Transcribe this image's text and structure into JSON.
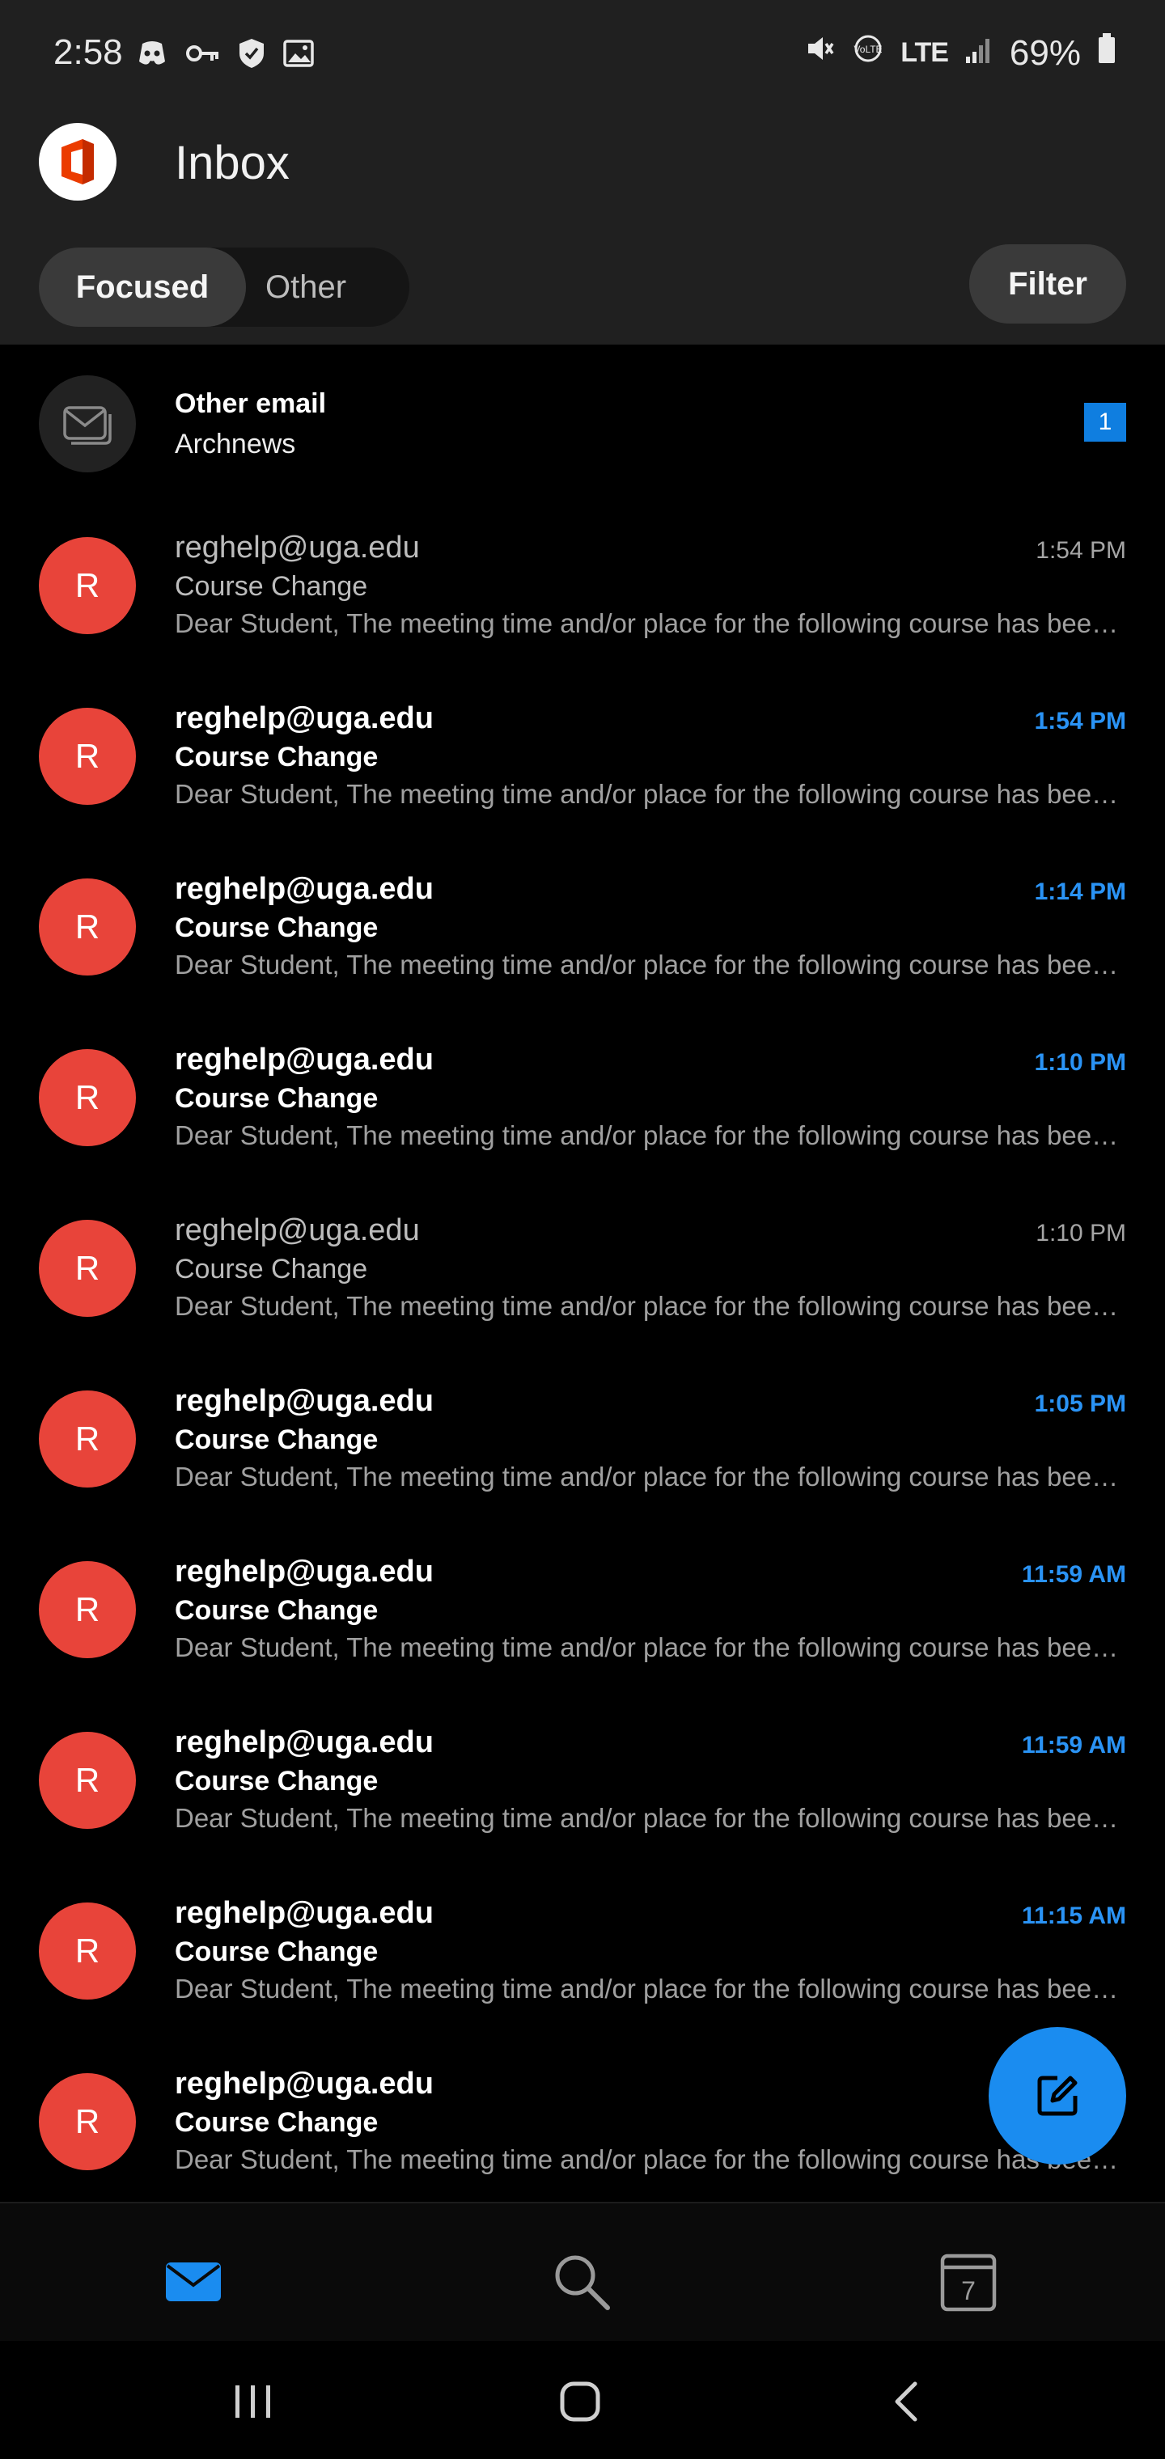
{
  "status_bar": {
    "time": "2:58",
    "network": "LTE",
    "battery": "69%"
  },
  "header": {
    "title": "Inbox",
    "tabs": [
      {
        "label": "Focused",
        "active": true
      },
      {
        "label": "Other",
        "active": false
      }
    ],
    "filter_label": "Filter"
  },
  "other_email": {
    "title": "Other email",
    "sender": "Archnews",
    "count": "1"
  },
  "emails": [
    {
      "initial": "R",
      "from": "reghelp@uga.edu",
      "time": "1:54 PM",
      "subject": "Course Change",
      "preview": "Dear Student, The meeting time and/or place for the following course has been changed",
      "unread": false
    },
    {
      "initial": "R",
      "from": "reghelp@uga.edu",
      "time": "1:54 PM",
      "subject": "Course Change",
      "preview": "Dear Student, The meeting time and/or place for the following course has been changed",
      "unread": true
    },
    {
      "initial": "R",
      "from": "reghelp@uga.edu",
      "time": "1:14 PM",
      "subject": "Course Change",
      "preview": "Dear Student, The meeting time and/or place for the following course has been changed",
      "unread": true
    },
    {
      "initial": "R",
      "from": "reghelp@uga.edu",
      "time": "1:10 PM",
      "subject": "Course Change",
      "preview": "Dear Student, The meeting time and/or place for the following course has been changed",
      "unread": true
    },
    {
      "initial": "R",
      "from": "reghelp@uga.edu",
      "time": "1:10 PM",
      "subject": "Course Change",
      "preview": "Dear Student, The meeting time and/or place for the following course has been changed",
      "unread": false
    },
    {
      "initial": "R",
      "from": "reghelp@uga.edu",
      "time": "1:05 PM",
      "subject": "Course Change",
      "preview": "Dear Student, The meeting time and/or place for the following course has been changed",
      "unread": true
    },
    {
      "initial": "R",
      "from": "reghelp@uga.edu",
      "time": "11:59 AM",
      "subject": "Course Change",
      "preview": "Dear Student, The meeting time and/or place for the following course has been changed",
      "unread": true
    },
    {
      "initial": "R",
      "from": "reghelp@uga.edu",
      "time": "11:59 AM",
      "subject": "Course Change",
      "preview": "Dear Student, The meeting time and/or place for the following course has been changed",
      "unread": true
    },
    {
      "initial": "R",
      "from": "reghelp@uga.edu",
      "time": "11:15 AM",
      "subject": "Course Change",
      "preview": "Dear Student, The meeting time and/or place for the following course has been changed",
      "unread": true
    },
    {
      "initial": "R",
      "from": "reghelp@uga.edu",
      "time": "",
      "subject": "Course Change",
      "preview": "Dear Student, The meeting time and/or place for the following course has been changed",
      "unread": true
    }
  ],
  "bottom_nav": {
    "calendar_day": "7"
  },
  "colors": {
    "accent": "#1a8cf0",
    "avatar": "#e8443a",
    "header_bg": "#202020"
  }
}
